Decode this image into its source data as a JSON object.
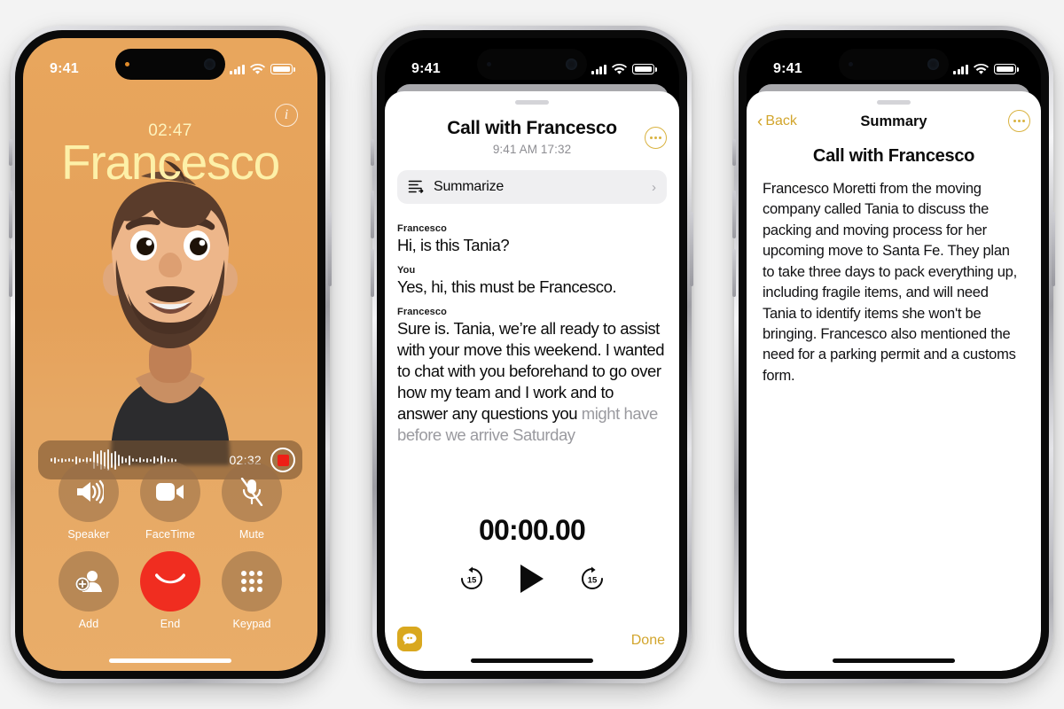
{
  "background_color": "#f3f3f3",
  "accent_color": "#d2a52c",
  "phone1": {
    "name": "in-call-screen",
    "background_color": "#e8a65d",
    "status_bar": {
      "time": "9:41",
      "signal_icon": "cellular-bars-icon",
      "wifi_icon": "wifi-icon",
      "battery_icon": "battery-icon"
    },
    "info_button_label": "i",
    "call_timer": "02:47",
    "caller_name": "Francesco",
    "caller_name_color": "#fdf0a8",
    "avatar": "memoji-avatar",
    "recording": {
      "time": "02:32",
      "waveform_icon": "audio-waveform-icon",
      "stop_button": "stop-recording-button",
      "stop_color": "#ee1f16"
    },
    "controls": [
      {
        "label": "Speaker",
        "icon": "speaker-icon"
      },
      {
        "label": "FaceTime",
        "icon": "video-camera-icon"
      },
      {
        "label": "Mute",
        "icon": "microphone-muted-icon"
      },
      {
        "label": "Add",
        "icon": "add-person-icon"
      },
      {
        "label": "End",
        "icon": "end-call-icon"
      },
      {
        "label": "Keypad",
        "icon": "keypad-icon"
      }
    ]
  },
  "phone2": {
    "name": "call-recording-detail-sheet",
    "status_bar": {
      "time": "9:41",
      "signal_icon": "cellular-bars-icon",
      "wifi_icon": "wifi-icon",
      "battery_icon": "battery-icon"
    },
    "title": "Call with Francesco",
    "subtitle": "9:41 AM  17:32",
    "more_button": "more-options-button",
    "summarize": {
      "label": "Summarize",
      "icon": "summarize-icon",
      "chevron": "›"
    },
    "transcript": [
      {
        "speaker": "Francesco",
        "text": "Hi, is this Tania?"
      },
      {
        "speaker": "You",
        "text": "Yes, hi, this must be Francesco."
      },
      {
        "speaker": "Francesco",
        "text": "Sure is. Tania, we’re all ready to assist with your move this weekend. I wanted to chat with you beforehand to go over how my team and I work and to answer any questions you ",
        "text_faded": "might have before we arrive Saturday"
      }
    ],
    "player": {
      "time": "00:00.00",
      "rewind_label": "15",
      "rewind_icon": "rewind-15-icon",
      "play_icon": "play-icon",
      "forward_label": "15",
      "forward_icon": "forward-15-icon"
    },
    "messages_icon": "messages-app-icon",
    "done_label": "Done"
  },
  "phone3": {
    "name": "call-summary-sheet",
    "status_bar": {
      "time": "9:41",
      "signal_icon": "cellular-bars-icon",
      "wifi_icon": "wifi-icon",
      "battery_icon": "battery-icon"
    },
    "back_label": "Back",
    "back_icon": "chevron-left-icon",
    "nav_title": "Summary",
    "more_button": "more-options-button",
    "title": "Call with Francesco",
    "body": "Francesco Moretti from the moving company called Tania to discuss the packing and moving process for her upcoming move to Santa Fe. They plan to take three days to pack everything up, including fragile items, and will need Tania to identify items she won't be bringing. Francesco also mentioned the need for a parking permit and a customs form."
  }
}
